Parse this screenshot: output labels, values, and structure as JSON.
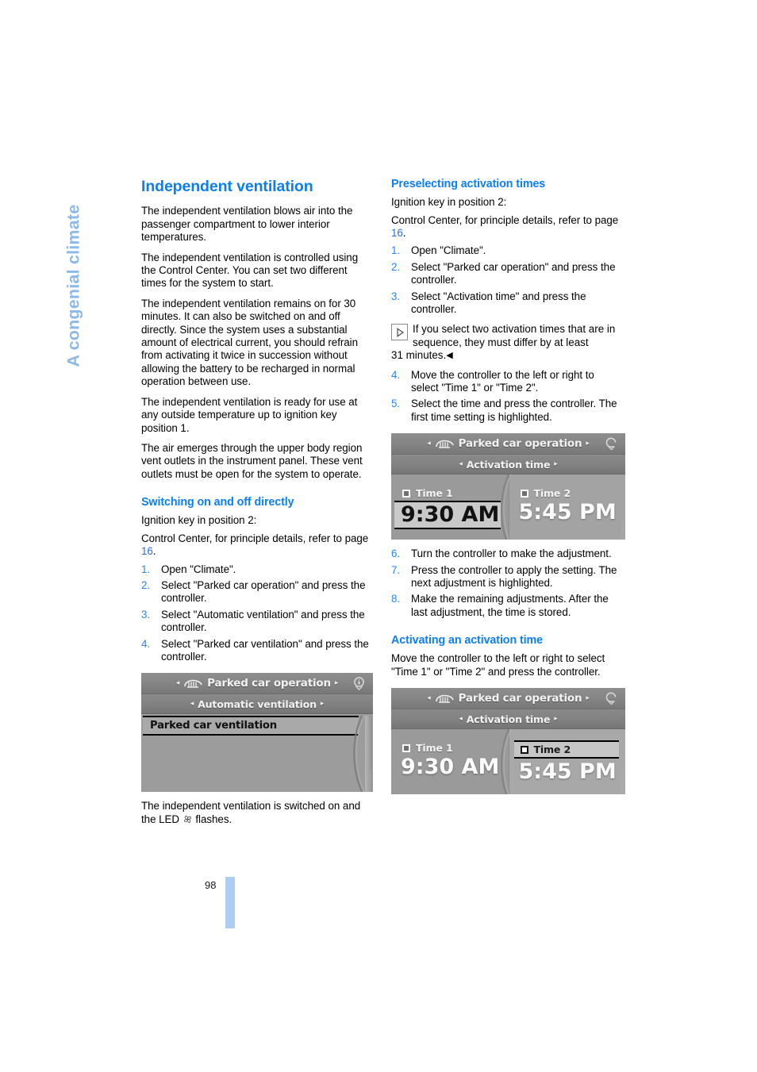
{
  "chapter_tab": "A congenial climate",
  "page_number": "98",
  "left_column": {
    "title": "Independent ventilation",
    "paragraphs": [
      "The independent ventilation blows air into the passenger compartment to lower interior temperatures.",
      "The independent ventilation is controlled using the Control Center. You can set two different times for the system to start.",
      "The independent ventilation remains on for 30 minutes. It can also be switched on and off directly. Since the system uses a substantial amount of electrical current, you should refrain from activating it twice in succession without allowing the battery to be recharged in normal operation between use.",
      "The independent ventilation is ready for use at any outside temperature up to ignition key position 1.",
      "The air emerges through the upper body region vent outlets in the instrument panel. These vent outlets must be open for the system to operate."
    ],
    "subsection": {
      "title": "Switching on and off directly",
      "intro1": "Ignition key in position 2:",
      "intro2_pre": "Control Center, for principle details, refer to page ",
      "intro2_link": "16",
      "intro2_post": ".",
      "steps": [
        {
          "num": "1.",
          "text": "Open \"Climate\"."
        },
        {
          "num": "2.",
          "text": "Select \"Parked car operation\" and press the controller."
        },
        {
          "num": "3.",
          "text": "Select \"Automatic ventilation\" and press the controller."
        },
        {
          "num": "4.",
          "text": "Select \"Parked car ventilation\" and press the controller."
        }
      ]
    },
    "screenshot": {
      "bar1_label": "Parked car operation",
      "bar2_label": "Automatic ventilation",
      "selected_item": "Parked car ventilation",
      "arrow_left": "◂",
      "arrow_right": "▸",
      "figure_id": "ICP76111Anbei"
    },
    "closing_pre": "The independent ventilation is switched on and the LED ",
    "closing_post": " flashes."
  },
  "right_column": {
    "section1": {
      "title": "Preselecting activation times",
      "intro1": "Ignition key in position 2:",
      "intro2_pre": "Control Center, for principle details, refer to page ",
      "intro2_link": "16",
      "intro2_post": ".",
      "steps_a": [
        {
          "num": "1.",
          "text": "Open \"Climate\"."
        },
        {
          "num": "2.",
          "text": "Select \"Parked car operation\" and press the controller."
        },
        {
          "num": "3.",
          "text": "Select \"Activation time\" and press the controller."
        }
      ],
      "note": "If you select two activation times that are in sequence, they must differ by at least",
      "note_tail": "31 minutes.",
      "note_endmark": "◀",
      "steps_b": [
        {
          "num": "4.",
          "text": "Move the controller to the left or right to select \"Time 1\" or \"Time 2\"."
        },
        {
          "num": "5.",
          "text": "Select the time and press the controller. The first time setting is highlighted."
        }
      ],
      "steps_c": [
        {
          "num": "6.",
          "text": "Turn the controller to make the adjustment."
        },
        {
          "num": "7.",
          "text": "Press the controller to apply the setting. The next adjustment is highlighted."
        },
        {
          "num": "8.",
          "text": "Make the remaining adjustments. After the last adjustment, the time is stored."
        }
      ]
    },
    "screenshot1": {
      "bar1_label": "Parked car operation",
      "bar2_label": "Activation time",
      "time1_label": "Time 1",
      "time1_value": "9:30 AM",
      "time2_label": "Time 2",
      "time2_value": "5:45 PM",
      "highlighted": "time1_value",
      "arrow_left": "◂",
      "arrow_right": "▸",
      "figure_id": "ICP76111Anbei"
    },
    "section2": {
      "title": "Activating an activation time",
      "body": "Move the controller to the left or right to select \"Time 1\" or \"Time 2\" and press the controller."
    },
    "screenshot2": {
      "bar1_label": "Parked car operation",
      "bar2_label": "Activation time",
      "time1_label": "Time 1",
      "time1_value": "9:30 AM",
      "time2_label": "Time 2",
      "time2_value": "5:45 PM",
      "highlighted": "time2_label",
      "arrow_left": "◂",
      "arrow_right": "▸",
      "figure_id": "ICP76111Anbei"
    }
  },
  "colors": {
    "heading_blue": "#0d7ef2",
    "step_number_blue": "#2b86ef",
    "chapter_tab_blue": "#8db9ea",
    "folio_bar_blue": "#aecdf2"
  }
}
